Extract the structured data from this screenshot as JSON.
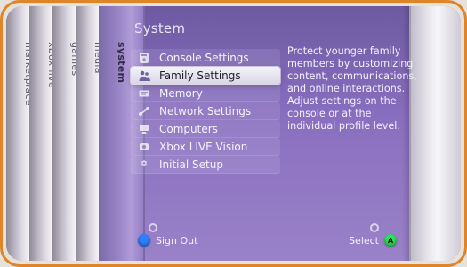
{
  "frame": {
    "border_color": "#e0842a"
  },
  "left_blades": [
    {
      "label": "marketplace"
    },
    {
      "label": "xbox live"
    },
    {
      "label": "games"
    },
    {
      "label": "media"
    },
    {
      "label": "system"
    }
  ],
  "panel": {
    "title": "System",
    "menu": [
      {
        "label": "Console Settings",
        "icon": "console-icon",
        "selected": false
      },
      {
        "label": "Family Settings",
        "icon": "family-icon",
        "selected": true
      },
      {
        "label": "Memory",
        "icon": "memory-icon",
        "selected": false
      },
      {
        "label": "Network Settings",
        "icon": "network-icon",
        "selected": false
      },
      {
        "label": "Computers",
        "icon": "computer-icon",
        "selected": false
      },
      {
        "label": "Xbox LIVE Vision",
        "icon": "camera-icon",
        "selected": false
      },
      {
        "label": "Initial Setup",
        "icon": "setup-icon",
        "selected": false
      }
    ],
    "description": "Protect younger family members by customizing content, communications, and online interactions. Adjust settings on the console or at the individual profile level."
  },
  "hints": {
    "left": {
      "label": "Sign Out",
      "button_color": "#2f7fff"
    },
    "right": {
      "label": "Select",
      "button_color": "#2fe05b",
      "button_glyph": "A"
    }
  }
}
